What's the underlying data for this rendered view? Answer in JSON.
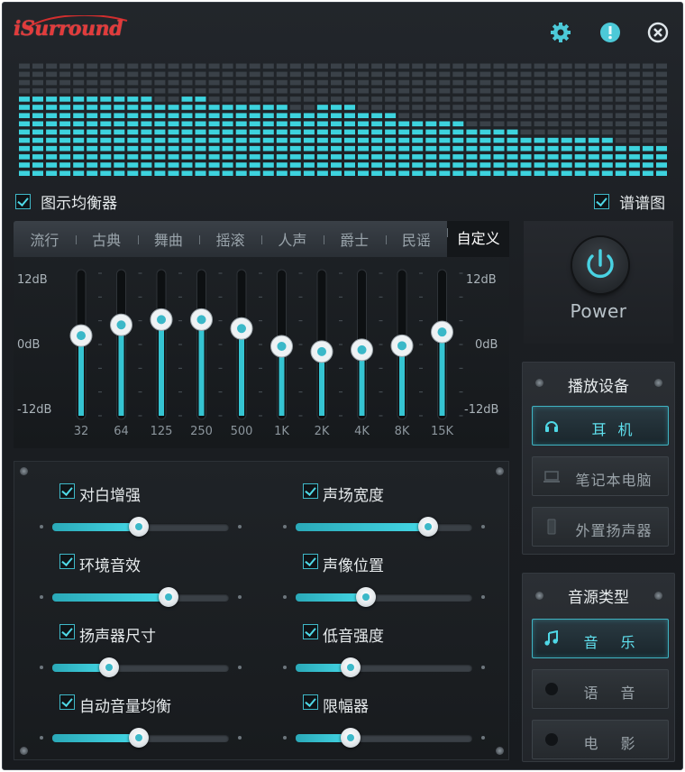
{
  "app": {
    "logo_text": "iSurround",
    "accent": "#3fc6d6",
    "header_buttons": [
      "gear-icon",
      "info-icon",
      "close-icon"
    ]
  },
  "spectrum": {
    "columns": 48,
    "rows": 14,
    "levels": [
      10,
      10,
      10,
      10,
      10,
      10,
      10,
      10,
      10,
      10,
      9,
      9,
      10,
      10,
      9,
      9,
      9,
      9,
      9,
      9,
      8,
      8,
      9,
      9,
      9,
      8,
      8,
      8,
      7,
      7,
      7,
      7,
      7,
      6,
      6,
      6,
      6,
      5,
      5,
      5,
      5,
      5,
      5,
      5,
      4,
      4,
      4,
      4
    ],
    "lit_color": "#3dd3de",
    "dim_color": "#3a4148"
  },
  "checkboxes": {
    "graphic_eq": "图示均衡器",
    "spectrum": "谱谱图"
  },
  "eq": {
    "presets": [
      "流行",
      "古典",
      "舞曲",
      "摇滚",
      "人声",
      "爵士",
      "民谣",
      "自定义"
    ],
    "active_preset": 7,
    "db_top": "12dB",
    "db_mid": "0dB",
    "db_bottom": "-12dB",
    "bands": [
      "32",
      "64",
      "125",
      "250",
      "500",
      "1K",
      "2K",
      "4K",
      "8K",
      "15K"
    ],
    "gains_db": [
      1.5,
      3.3,
      4.2,
      4.2,
      2.7,
      -0.3,
      -1.2,
      -0.9,
      -0.2,
      2.1
    ],
    "range_db": [
      -12,
      12
    ]
  },
  "power": {
    "label": "Power"
  },
  "device": {
    "title": "播放设备",
    "options": [
      {
        "label": "耳 机",
        "icon": "headphones-icon",
        "active": true
      },
      {
        "label": "笔记本电脑",
        "icon": "laptop-icon",
        "active": false
      },
      {
        "label": "外置扬声器",
        "icon": "speaker-icon",
        "active": false
      }
    ]
  },
  "source": {
    "title": "音源类型",
    "options": [
      {
        "label": "音 乐",
        "icon": "music-note-icon",
        "active": true
      },
      {
        "label": "语 音",
        "icon": "voice-icon",
        "active": false
      },
      {
        "label": "电 影",
        "icon": "movie-icon",
        "active": false
      }
    ]
  },
  "effects": [
    {
      "label": "对白增强",
      "value": 0.49
    },
    {
      "label": "声场宽度",
      "value": 0.75
    },
    {
      "label": "环境音效",
      "value": 0.66
    },
    {
      "label": "声像位置",
      "value": 0.4
    },
    {
      "label": "扬声器尺寸",
      "value": 0.32
    },
    {
      "label": "低音强度",
      "value": 0.31
    },
    {
      "label": "自动音量均衡",
      "value": 0.49
    },
    {
      "label": "限幅器",
      "value": 0.31
    }
  ]
}
